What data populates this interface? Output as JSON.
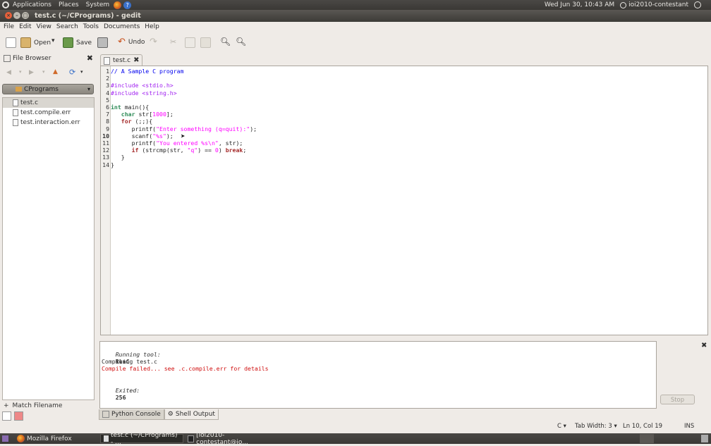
{
  "top_panel": {
    "menus": [
      "Applications",
      "Places",
      "System"
    ],
    "clock": "Wed Jun 30, 10:43 AM",
    "user": "ioi2010-contestant"
  },
  "window": {
    "title": "test.c (~/CPrograms) - gedit"
  },
  "menu_bar": [
    "File",
    "Edit",
    "View",
    "Search",
    "Tools",
    "Documents",
    "Help"
  ],
  "toolbar": {
    "open_label": "Open",
    "save_label": "Save",
    "undo_label": "Undo"
  },
  "side_panel": {
    "title": "File Browser",
    "folder": "CPrograms",
    "files": [
      "test.c",
      "test.compile.err",
      "test.interaction.err"
    ],
    "match_filename": "Match Filename"
  },
  "document": {
    "tab_label": "test.c",
    "current_line": 10,
    "lines": [
      "// A Sample C program",
      "",
      "#include <stdio.h>",
      "#include <string.h>",
      "",
      "int main(){",
      "   char str[1000];",
      "   for (;;){",
      "      printf(\"Enter something (q=quit):\");",
      "      scanf(\"%s\");",
      "      printf(\"You entered %s\\n\", str);",
      "      if (strcmp(str, \"q\") == 0) break;",
      "   }",
      "}"
    ]
  },
  "output": {
    "running_label": "Running tool:",
    "running_tool": "RunC",
    "compiling": "Compiling test.c",
    "error": "Compile failed... see .c.compile.err for details",
    "exited_label": "Exited:",
    "exit_code": "256",
    "stop_label": "Stop"
  },
  "bottom_tabs": [
    "Python Console",
    "Shell Output"
  ],
  "status_bar": {
    "language": "C",
    "tab_width": "Tab Width: 3",
    "position": "Ln 10, Col 19",
    "mode": "INS"
  },
  "taskbar": [
    "Mozilla Firefox",
    "test.c (~/CPrograms) - ...",
    "[ioi2010-contestant@io..."
  ]
}
